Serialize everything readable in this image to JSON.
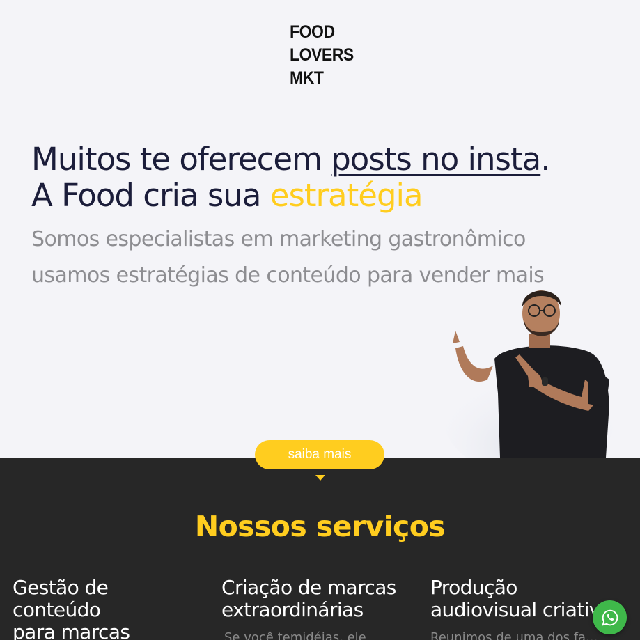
{
  "logo": {
    "line1": "FOOD",
    "line2": "LOVERS",
    "line3": "MKT"
  },
  "hero": {
    "headline_part1": "Muitos te oferecem ",
    "headline_underlined": "posts no insta",
    "headline_period": ".",
    "headline_line2_part1": "A Food cria sua ",
    "headline_accent": "estratégia",
    "sub_line1": "Somos especialistas em marketing gastronômico",
    "sub_line2": "usamos estratégias de conteúdo para vender mais"
  },
  "cta": {
    "label": "saiba mais"
  },
  "services": {
    "title": "Nossos serviços",
    "items": [
      {
        "title": "Gestão de\nconteúdo\npara marcas",
        "desc": ""
      },
      {
        "title": "Criação de marcas\nextraordinárias",
        "desc": "Se você temidéias, ele"
      },
      {
        "title": "Produção\naudiovisual criativa",
        "desc": "Reunimos de uma dos fa..."
      }
    ]
  },
  "colors": {
    "accent": "#ffcd1f",
    "dark_bg": "#272727",
    "headline": "#1b1d3a",
    "whatsapp": "#3fb84a"
  },
  "icons": {
    "whatsapp": "whatsapp-icon",
    "caret": "caret-down-icon"
  }
}
